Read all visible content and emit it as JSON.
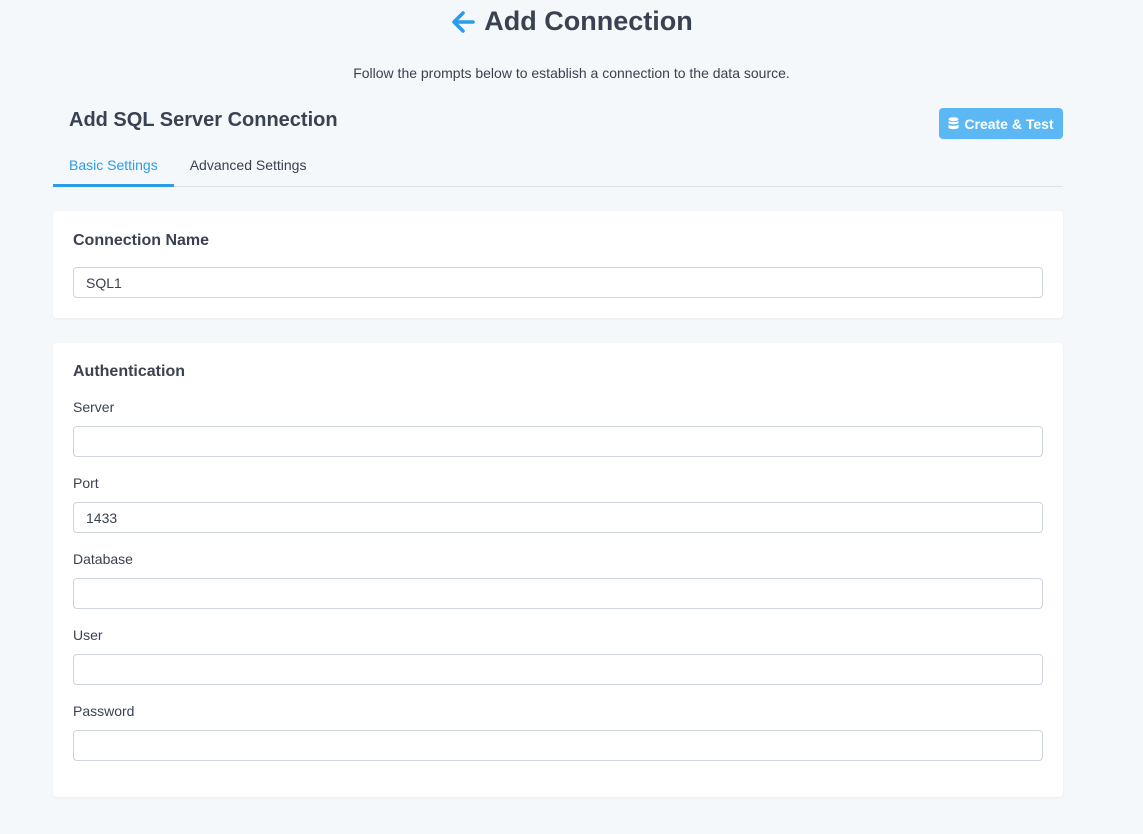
{
  "header": {
    "title": "Add Connection",
    "subtitle": "Follow the prompts below to establish a connection to the data source."
  },
  "section": {
    "title": "Add SQL Server Connection",
    "create_button_label": "Create & Test",
    "create_button_icon": "database-icon"
  },
  "tabs": [
    {
      "label": "Basic Settings",
      "active": true
    },
    {
      "label": "Advanced Settings",
      "active": false
    }
  ],
  "connection_name": {
    "heading": "Connection Name",
    "value": "SQL1"
  },
  "authentication": {
    "heading": "Authentication",
    "fields": [
      {
        "label": "Server",
        "value": ""
      },
      {
        "label": "Port",
        "value": "1433"
      },
      {
        "label": "Database",
        "value": ""
      },
      {
        "label": "User",
        "value": ""
      },
      {
        "label": "Password",
        "value": ""
      }
    ]
  },
  "colors": {
    "accent": "#2a9ce8",
    "button": "#5bb8f5",
    "background": "#f5f8fb",
    "text": "#3a4150"
  }
}
